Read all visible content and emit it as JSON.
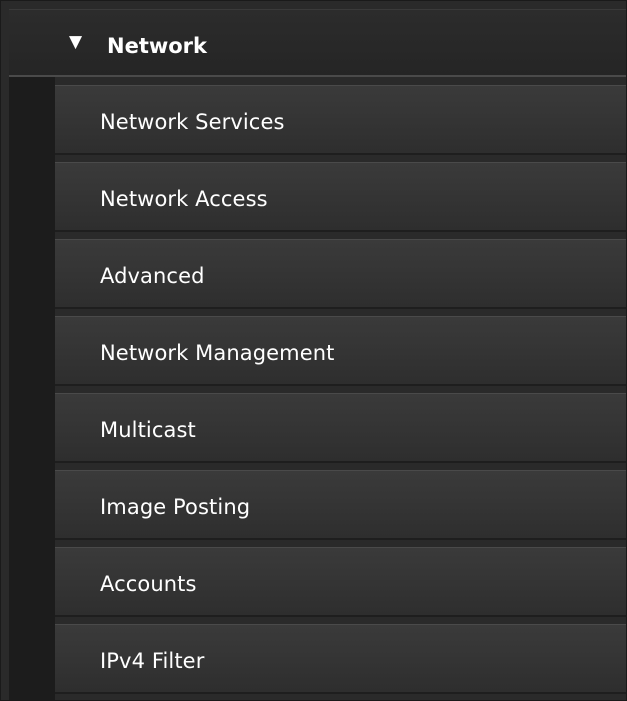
{
  "section": {
    "title": "Network",
    "expanded_glyph": "▼",
    "icon": "caret-down-icon"
  },
  "menu": {
    "items": [
      {
        "label": "Network Services"
      },
      {
        "label": "Network Access"
      },
      {
        "label": "Advanced"
      },
      {
        "label": "Network Management"
      },
      {
        "label": "Multicast"
      },
      {
        "label": "Image Posting"
      },
      {
        "label": "Accounts"
      },
      {
        "label": "IPv4 Filter"
      }
    ]
  }
}
